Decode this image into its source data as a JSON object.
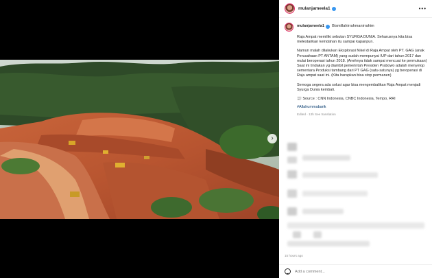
{
  "post": {
    "username": "mulanjameela1",
    "first_line": "Bismillahirrahmanirrahim",
    "paragraphs": [
      "Raja Ampat memiliki sebutan SYURGA DUNIA. Seharusnya kita bisa melestarikan keindahan itu sampai kapanpun.",
      "Namun malah dilakukan Eksplorasi Nikel di Raja Ampat oleh PT. GAG (anak Perusahaan PT ANTAM) yang sudah mempunyai IUP dari tahun 2017 dan mulai beroperasi tahun 2018. (Anehnya tidak sampai mencuat ke permukaan)",
      "Saat ini tindakan yg diambil pemerintah Presiden Prabowo adalah menyetop sementara Produksi tambang dari PT GAG (satu-satunya) yg beroperasi di Raja ampat saat ini. (Kita harapkan bisa stop permanen)",
      "Semoga segera ada solusi agar bisa mengembalikan Raja Ampat menjadi Syurga Dunia kembali.",
      "📰 Source : CNN Indonesia, CNBC Indonesia, Tempo, RRI"
    ],
    "hashtag": "#Allahummabarik",
    "meta": "Edited · 13h    See translation",
    "time_ago": "15 hours ago"
  },
  "comment": {
    "placeholder": "Add a comment..."
  },
  "icons": {
    "verified": "verified-badge-icon",
    "more": "more-options-icon",
    "next": "chevron-right-icon",
    "emoji": "emoji-icon"
  },
  "colors": {
    "verified": "#3897f0",
    "hashtag": "#00376b",
    "muted": "#8e8e8e"
  }
}
